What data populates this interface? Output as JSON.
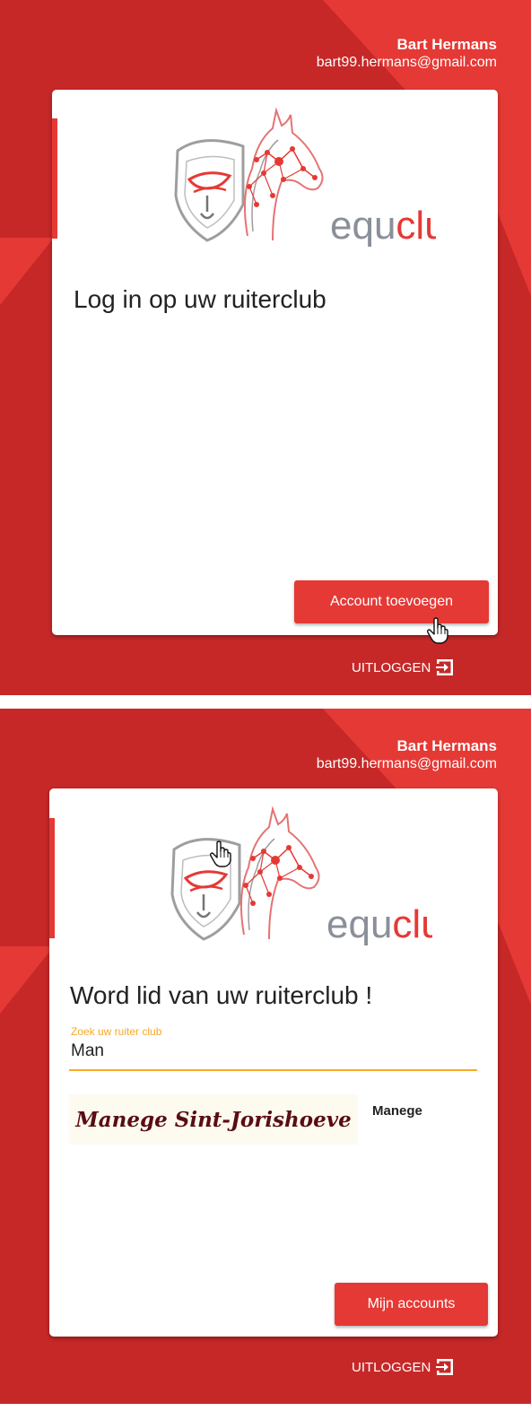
{
  "user": {
    "name": "Bart Hermans",
    "email": "bart99.hermans@gmail.com"
  },
  "brand": {
    "logo_text_a": "equ",
    "logo_text_b": "club"
  },
  "colors": {
    "accent": "#e53935",
    "background": "#c62828",
    "focus": "#f9a825"
  },
  "screen_login": {
    "title": "Log in op uw ruiterclub",
    "add_account_label": "Account toevoegen",
    "logout_label": "UITLOGGEN"
  },
  "screen_join": {
    "title": "Word lid van uw ruiterclub !",
    "search": {
      "label": "Zoek uw ruiter club",
      "value": "Man"
    },
    "results": [
      {
        "name": "Manege Sint-Jorishoeve",
        "type": "Manege"
      }
    ],
    "my_accounts_label": "Mijn accounts",
    "logout_label": "UITLOGGEN"
  },
  "icons": {
    "logout": "logout-arrow-icon",
    "cursor": "hand-pointer-icon"
  }
}
